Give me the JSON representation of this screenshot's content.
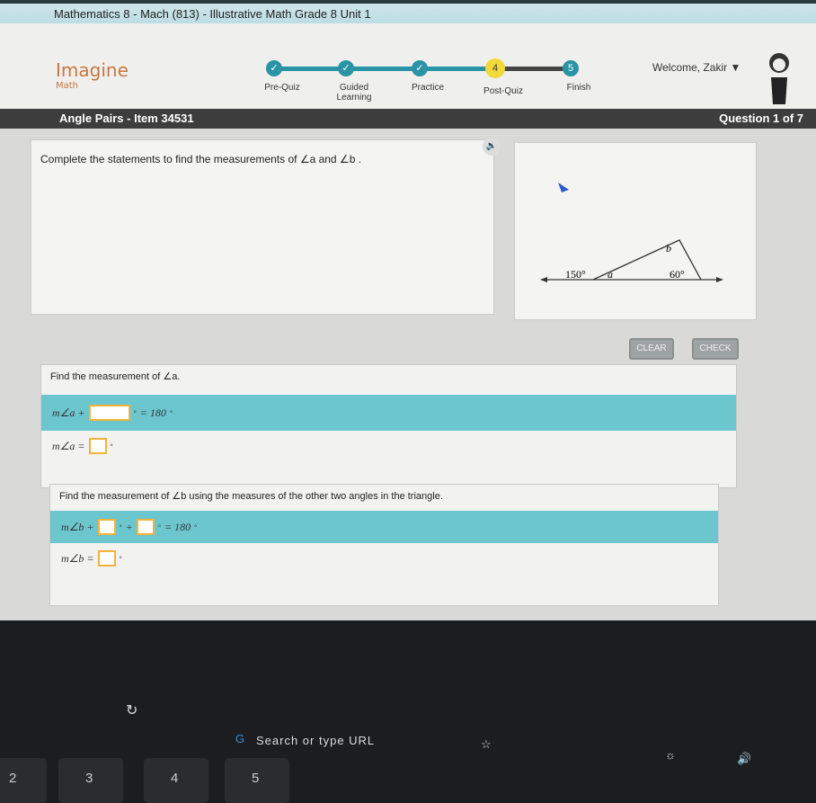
{
  "window_title": "Mathematics 8 - Mach (813) - Illustrative Math Grade 8 Unit 1",
  "logo": {
    "name": "Imagine",
    "sub": "Math"
  },
  "steps": [
    {
      "label": "Pre-Quiz",
      "state": "done",
      "glyph": "✓"
    },
    {
      "label": "Guided Learning",
      "state": "done",
      "glyph": "✓"
    },
    {
      "label": "Practice",
      "state": "done",
      "glyph": "✓"
    },
    {
      "label": "Post-Quiz",
      "state": "current",
      "glyph": "4"
    },
    {
      "label": "Finish",
      "state": "todo",
      "glyph": "5"
    }
  ],
  "welcome": "Welcome, Zakir ▼",
  "lesson_title": "Angle Pairs - Item 34531",
  "question_counter": "Question 1 of 7",
  "prompt": "Complete the statements to find the measurements of ∠a and ∠b .",
  "figure": {
    "angle1": "150°",
    "a": "a",
    "b": "b",
    "angle2": "60°"
  },
  "buttons": {
    "clear": "CLEAR",
    "check": "CHECK"
  },
  "part1": {
    "heading": "Find the measurement of ∠a.",
    "eq1_left": "m∠a +",
    "eq1_right": "= 180",
    "eq2_left": "m∠a ="
  },
  "part2": {
    "heading": "Find the measurement of ∠b using the measures of the other two angles in the triangle.",
    "eq1_left": "m∠b +",
    "plus": "+",
    "eq1_right": "= 180",
    "eq2_left": "m∠b ="
  },
  "degree": "°",
  "shelf": {
    "search": "Search or type URL"
  },
  "keys": [
    "2",
    "3",
    "4",
    "5"
  ],
  "colors": {
    "teal": "#2a93a6",
    "current": "#f1d93a",
    "answer_row": "#6cc6ce",
    "input_border": "#f3b23a"
  }
}
